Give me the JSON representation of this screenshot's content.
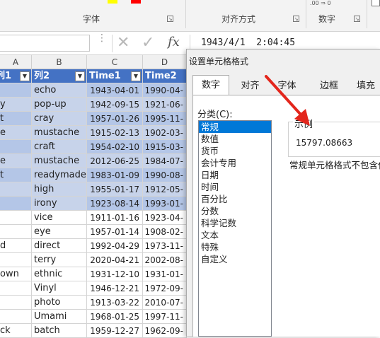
{
  "ribbon": {
    "font_group": "字体",
    "align_group": "对齐方式",
    "number_group": "数字",
    "decimals_hint": ".00 ⇒ 0"
  },
  "formula_bar": {
    "cancel": "✕",
    "enter": "✓",
    "fx": "fx",
    "value": "1943/4/1  2:04:45"
  },
  "columns": [
    "A",
    "B",
    "C",
    "D"
  ],
  "header_row": [
    "列1",
    "列2",
    "Time1",
    "Time2"
  ],
  "rows": [
    {
      "a": "",
      "b": "echo",
      "c": "1943-04-01",
      "d": "1990-04-"
    },
    {
      "a": "y",
      "b": "pop-up",
      "c": "1942-09-15",
      "d": "1921-06-"
    },
    {
      "a": "t",
      "b": "cray",
      "c": "1957-01-26",
      "d": "1995-11-"
    },
    {
      "a": "e",
      "b": "mustache",
      "c": "1915-02-13",
      "d": "1902-03-"
    },
    {
      "a": "",
      "b": "craft",
      "c": "1954-02-10",
      "d": "1915-03-"
    },
    {
      "a": "e",
      "b": "mustache",
      "c": "2012-06-25",
      "d": "1984-07-"
    },
    {
      "a": "t",
      "b": "readymade",
      "c": "1983-01-09",
      "d": "1990-08-"
    },
    {
      "a": "",
      "b": "high",
      "c": "1955-01-17",
      "d": "1912-05-"
    },
    {
      "a": "",
      "b": "irony",
      "c": "1923-08-14",
      "d": "1993-01-"
    },
    {
      "a": "",
      "b": "vice",
      "c": "1911-01-16",
      "d": "1923-04-"
    },
    {
      "a": "",
      "b": "eye",
      "c": "1957-01-14",
      "d": "1908-02-"
    },
    {
      "a": "d",
      "b": "direct",
      "c": "1992-04-29",
      "d": "1973-11-"
    },
    {
      "a": "",
      "b": "terry",
      "c": "2020-04-21",
      "d": "2002-08-"
    },
    {
      "a": "own",
      "b": "ethnic",
      "c": "1931-12-10",
      "d": "1931-01-"
    },
    {
      "a": "",
      "b": "Vinyl",
      "c": "1946-12-21",
      "d": "1972-09-"
    },
    {
      "a": "",
      "b": "photo",
      "c": "1913-03-22",
      "d": "2010-07-"
    },
    {
      "a": "",
      "b": "Umami",
      "c": "1968-01-25",
      "d": "1997-11-"
    },
    {
      "a": "ck",
      "b": "batch",
      "c": "1959-12-27",
      "d": "1962-09-"
    }
  ],
  "dialog": {
    "title": "设置单元格格式",
    "tabs": [
      "数字",
      "对齐",
      "字体",
      "边框",
      "填充"
    ],
    "category_label": "分类(C):",
    "categories": [
      "常规",
      "数值",
      "货币",
      "会计专用",
      "日期",
      "时间",
      "百分比",
      "分数",
      "科学记数",
      "文本",
      "特殊",
      "自定义"
    ],
    "sample_label": "示例",
    "sample_value": "15797.08663",
    "description": "常规单元格格式不包含任"
  },
  "colors": {
    "header_blue": "#4472c4",
    "band_blue": "#b4c6e7",
    "selection_blue": "#0078d7",
    "arrow_red": "#e3261c",
    "font_color_swatch": "#ff0000",
    "highlight_swatch": "#ffff00"
  }
}
